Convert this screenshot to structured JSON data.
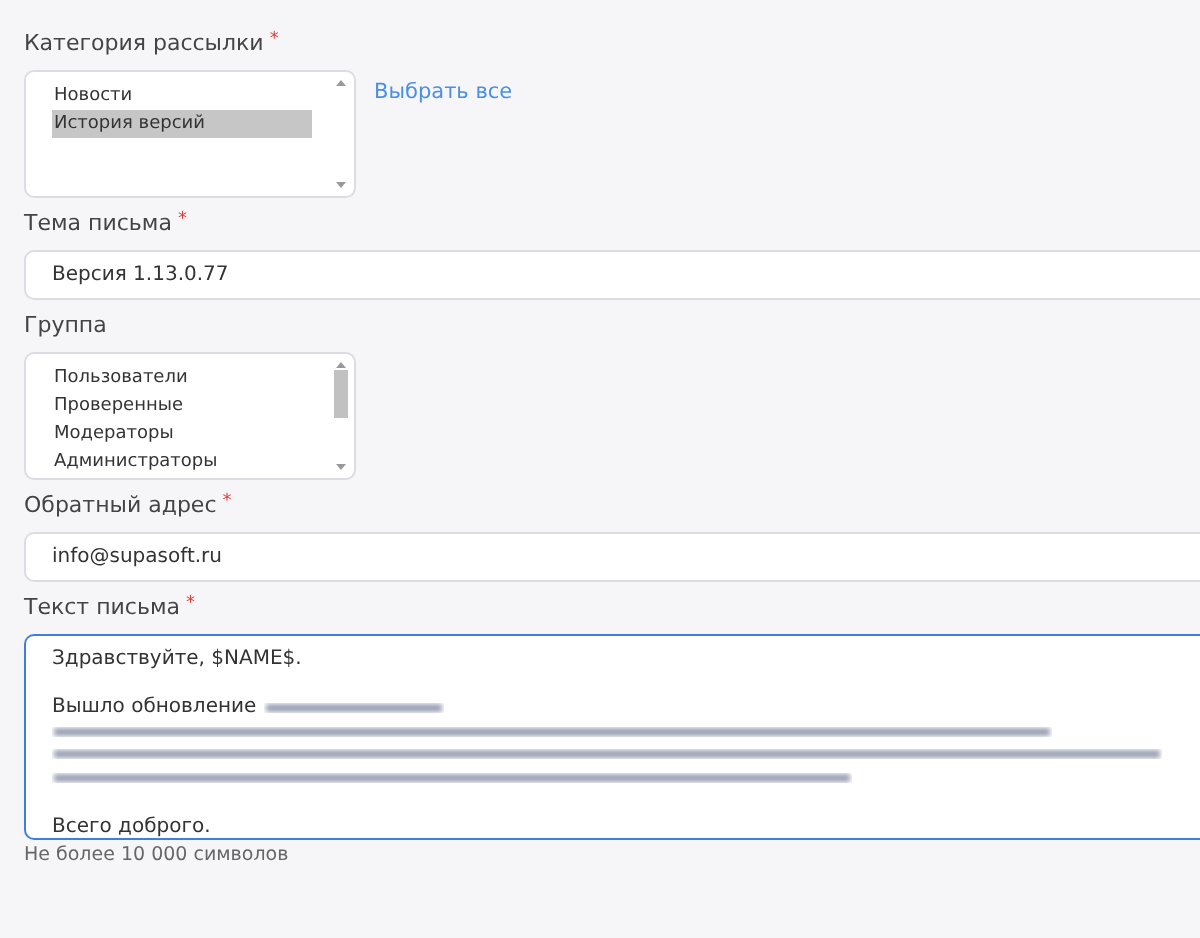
{
  "fields": [
    {
      "kind": "listbox",
      "label": "Категория рассылки",
      "required_mark": "*",
      "link": "Выбрать все",
      "scroll_thumb": false,
      "options": [
        {
          "label": "Новости",
          "selected": false
        },
        {
          "label": "История версий",
          "selected": true
        }
      ]
    },
    {
      "kind": "input",
      "label": "Тема письма",
      "required_mark": "*",
      "value": "Версия 1.13.0.77"
    },
    {
      "kind": "listbox",
      "label": "Группа",
      "scroll_thumb": true,
      "options": [
        {
          "label": "Пользователи",
          "selected": false
        },
        {
          "label": "Проверенные",
          "selected": false
        },
        {
          "label": "Модераторы",
          "selected": false
        },
        {
          "label": "Администраторы",
          "selected": false
        }
      ]
    },
    {
      "kind": "input",
      "label": "Обратный адрес",
      "required_mark": "*",
      "value": "info@supasoft.ru"
    },
    {
      "kind": "textarea",
      "label": "Текст письма",
      "required_mark": "*",
      "focused": true,
      "hint": "Не более 10 000 символов",
      "lines": [
        {
          "kind": "text",
          "text": "Здравствуйте, $NAME$."
        },
        {
          "kind": "blank"
        },
        {
          "kind": "text",
          "text": "Вышло обновление",
          "blurred_tail": true
        },
        {
          "kind": "blurred"
        },
        {
          "kind": "blurred"
        },
        {
          "kind": "blurred"
        },
        {
          "kind": "blank"
        },
        {
          "kind": "text",
          "text": "Всего доброго."
        }
      ]
    }
  ]
}
